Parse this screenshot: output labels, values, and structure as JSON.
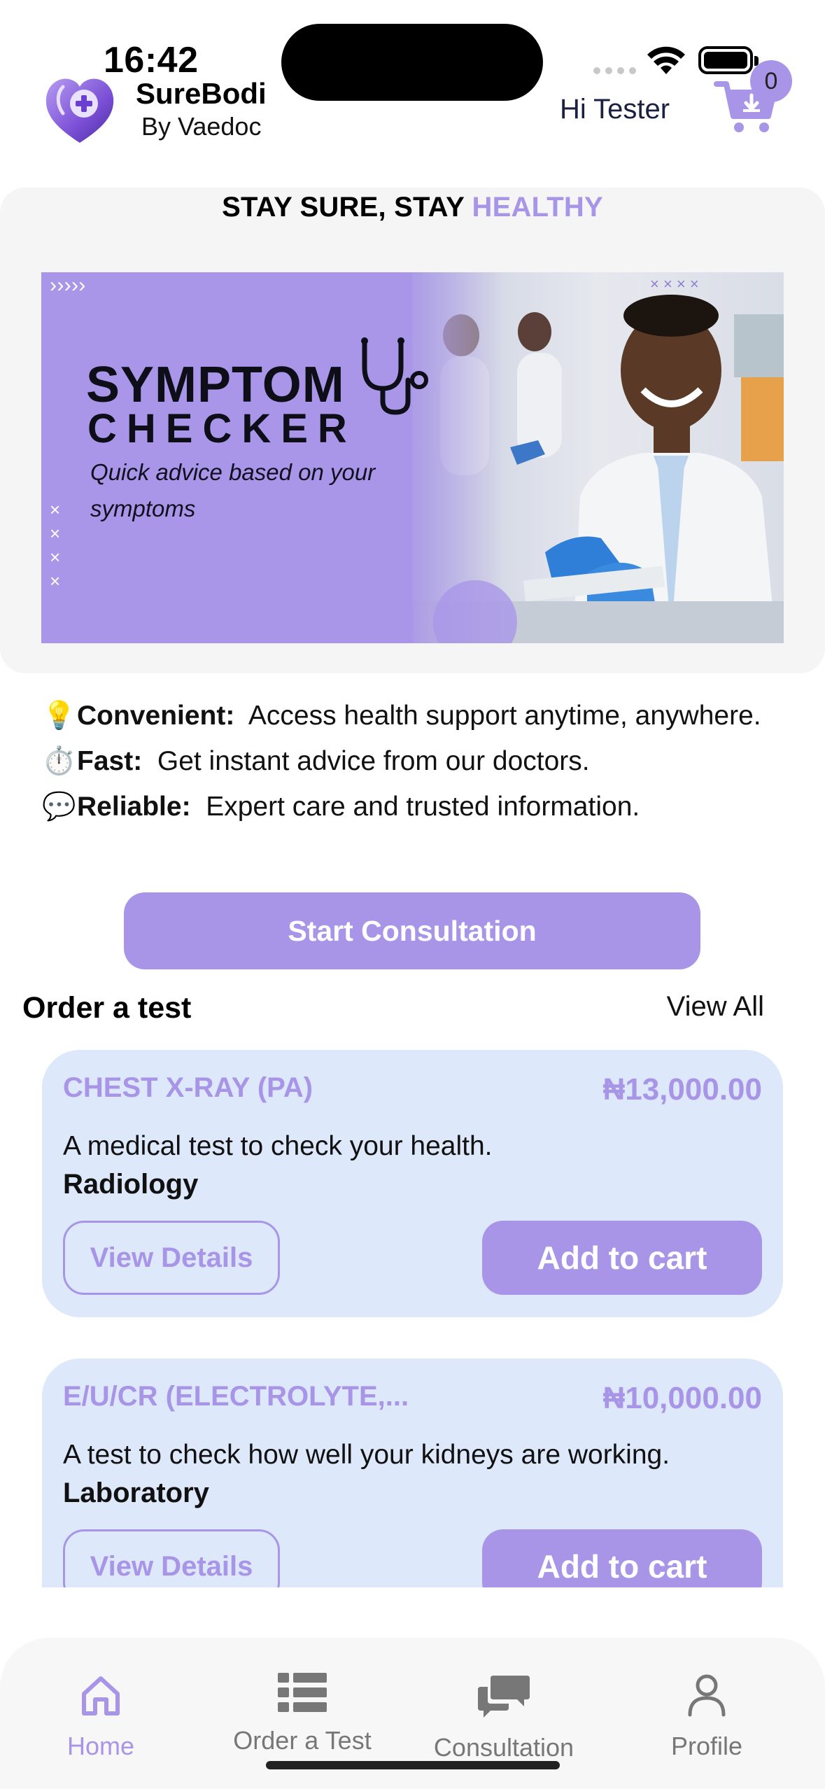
{
  "status_bar": {
    "time": "16:42"
  },
  "header": {
    "brand_name": "SureBodi",
    "brand_sub": "By Vaedoc",
    "greeting": "Hi Tester",
    "cart_count": "0"
  },
  "hero": {
    "tagline_main": "STAY SURE, STAY ",
    "tagline_accent": "HEALTHY",
    "banner": {
      "title_line1": "SYMPTOM",
      "title_line2": "CHECKER",
      "subtitle": "Quick advice based on your symptoms"
    }
  },
  "features": [
    {
      "icon": "lightbulb-icon",
      "emoji": "💡",
      "label": "Convenient:",
      "text": "Access health support anytime, anywhere."
    },
    {
      "icon": "stopwatch-icon",
      "emoji": "⏱️",
      "label": "Fast:",
      "text": "Get instant advice from our doctors."
    },
    {
      "icon": "speech-bubble-icon",
      "emoji": "💬",
      "label": "Reliable:",
      "text": "Expert care and trusted information."
    }
  ],
  "start_consultation_label": "Start Consultation",
  "order_section": {
    "title": "Order a test",
    "view_all": "View All",
    "tests": [
      {
        "name": "CHEST X-RAY (PA)",
        "price": "₦13,000.00",
        "description": "A medical test to check your health.",
        "category": "Radiology",
        "details_label": "View Details",
        "add_label": "Add to cart"
      },
      {
        "name": "E/U/CR (ELECTROLYTE,...",
        "price": "₦10,000.00",
        "description": "A test to check how well your kidneys are working.",
        "category": "Laboratory",
        "details_label": "View Details",
        "add_label": "Add to cart"
      }
    ]
  },
  "tab_bar": {
    "active": "Home",
    "tabs": [
      {
        "label": "Home",
        "icon": "home-icon"
      },
      {
        "label": "Order a Test",
        "icon": "list-icon"
      },
      {
        "label": "Consultation",
        "icon": "chat-bubbles-icon"
      },
      {
        "label": "Profile",
        "icon": "person-icon"
      }
    ]
  },
  "colors": {
    "accent": "#a895e8",
    "card_bg": "#dde8fb",
    "hero_bg": "#f5f5f5"
  }
}
